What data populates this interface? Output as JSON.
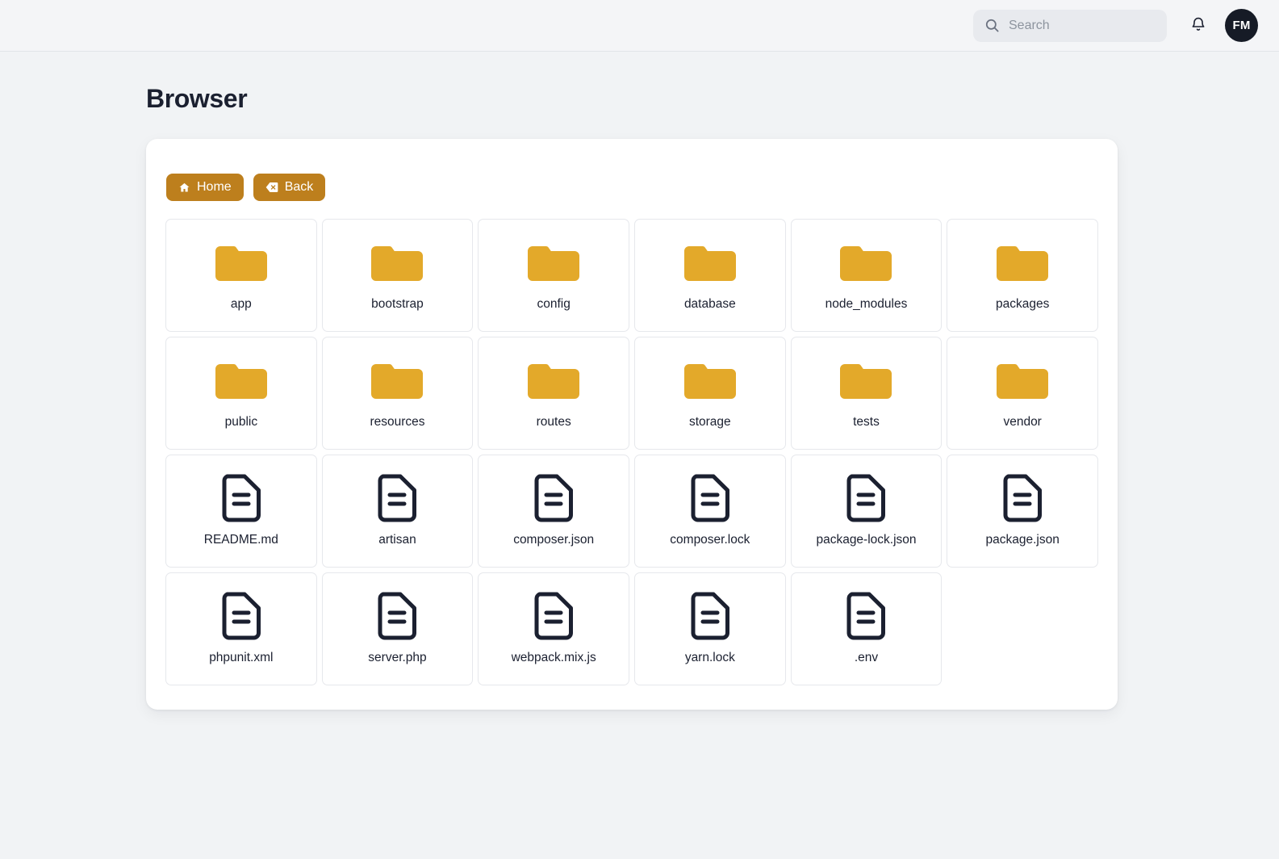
{
  "header": {
    "search": {
      "placeholder": "Search",
      "value": "",
      "icon": "search-icon"
    },
    "notifications_icon": "bell-icon",
    "avatar_initials": "FM"
  },
  "page": {
    "title": "Browser"
  },
  "toolbar": {
    "home_label": "Home",
    "home_icon": "home-icon",
    "back_label": "Back",
    "back_icon": "backspace-icon",
    "button_color": "#bd7f1d"
  },
  "colors": {
    "folder": "#e3a92a",
    "file": "#1b2030",
    "page_background": "#f1f3f5",
    "panel_background": "#ffffff"
  },
  "browser": {
    "items": [
      {
        "name": "app",
        "type": "folder"
      },
      {
        "name": "bootstrap",
        "type": "folder"
      },
      {
        "name": "config",
        "type": "folder"
      },
      {
        "name": "database",
        "type": "folder"
      },
      {
        "name": "node_modules",
        "type": "folder"
      },
      {
        "name": "packages",
        "type": "folder"
      },
      {
        "name": "public",
        "type": "folder"
      },
      {
        "name": "resources",
        "type": "folder"
      },
      {
        "name": "routes",
        "type": "folder"
      },
      {
        "name": "storage",
        "type": "folder"
      },
      {
        "name": "tests",
        "type": "folder"
      },
      {
        "name": "vendor",
        "type": "folder"
      },
      {
        "name": "README.md",
        "type": "file"
      },
      {
        "name": "artisan",
        "type": "file"
      },
      {
        "name": "composer.json",
        "type": "file"
      },
      {
        "name": "composer.lock",
        "type": "file"
      },
      {
        "name": "package-lock.json",
        "type": "file"
      },
      {
        "name": "package.json",
        "type": "file"
      },
      {
        "name": "phpunit.xml",
        "type": "file"
      },
      {
        "name": "server.php",
        "type": "file"
      },
      {
        "name": "webpack.mix.js",
        "type": "file"
      },
      {
        "name": "yarn.lock",
        "type": "file"
      },
      {
        "name": ".env",
        "type": "file"
      }
    ]
  }
}
